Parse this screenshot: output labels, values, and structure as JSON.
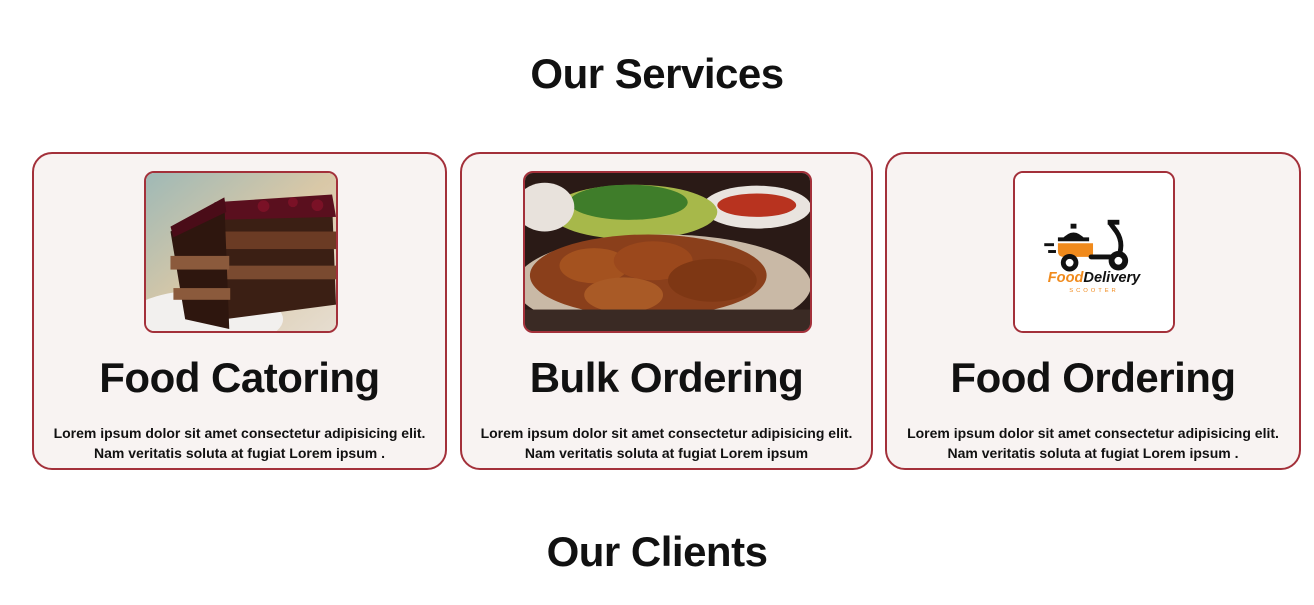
{
  "services": {
    "title": "Our Services",
    "cards": [
      {
        "title": "Food Catoring",
        "desc_line1": "Lorem ipsum dolor sit amet consectetur adipisicing elit.",
        "desc_line2": "Nam veritatis soluta at fugiat Lorem ipsum ."
      },
      {
        "title": "Bulk Ordering",
        "desc_line1": "Lorem ipsum dolor sit amet consectetur adipisicing elit.",
        "desc_line2": "Nam veritatis soluta at fugiat Lorem ipsum"
      },
      {
        "title": "Food Ordering",
        "desc_line1": "Lorem ipsum dolor sit amet consectetur adipisicing elit.",
        "desc_line2": "Nam veritatis soluta at fugiat Lorem ipsum ."
      }
    ]
  },
  "logo": {
    "brand_food": "Food",
    "brand_delivery": "Delivery",
    "brand_sub": "SCOOTER"
  },
  "clients": {
    "title": "Our Clients"
  },
  "colors": {
    "card_border": "#a3303a",
    "card_bg": "#f8f3f2",
    "logo_orange": "#f08a1c"
  }
}
